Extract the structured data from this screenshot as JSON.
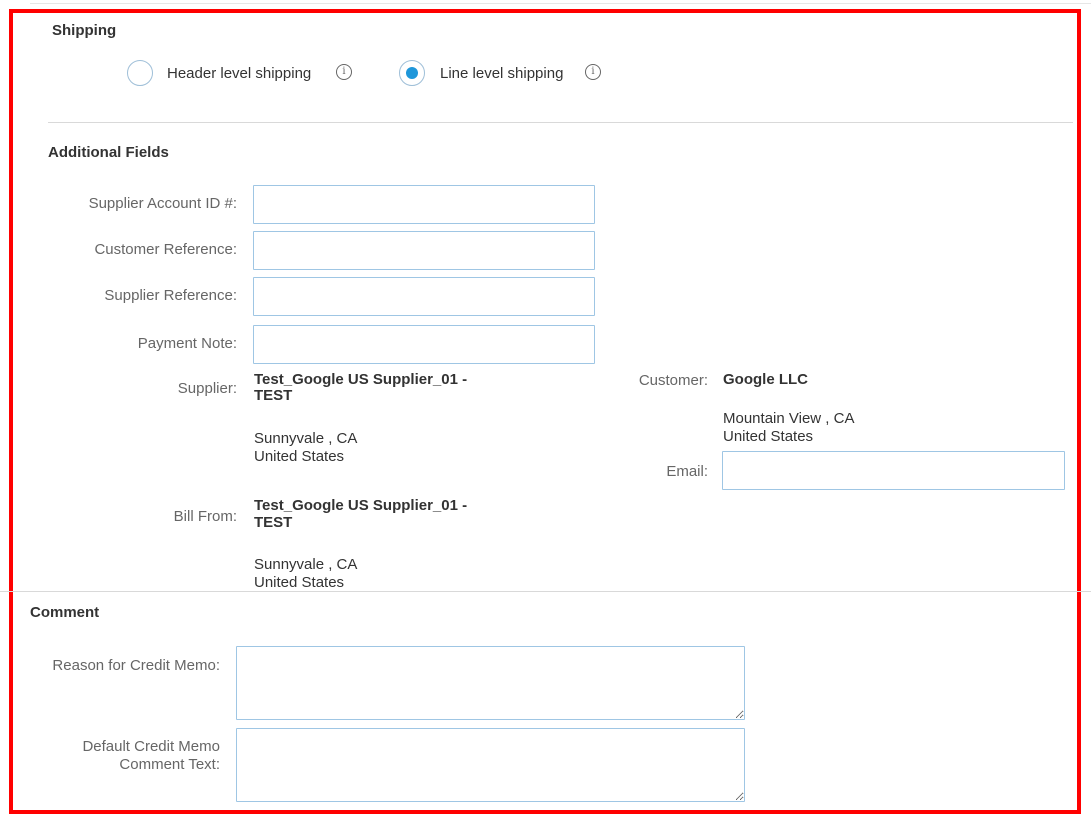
{
  "shipping": {
    "heading": "Shipping",
    "options": [
      {
        "label": "Header level shipping",
        "selected": false
      },
      {
        "label": "Line level shipping",
        "selected": true
      }
    ]
  },
  "additional_fields": {
    "heading": "Additional Fields",
    "supplier_account_id": {
      "label": "Supplier Account ID #:",
      "value": ""
    },
    "customer_reference": {
      "label": "Customer Reference:",
      "value": ""
    },
    "supplier_reference": {
      "label": "Supplier Reference:",
      "value": ""
    },
    "payment_note": {
      "label": "Payment Note:",
      "value": ""
    },
    "supplier": {
      "label": "Supplier:",
      "name_line1": "Test_Google US Supplier_01 -",
      "name_line2": "TEST",
      "city_state": "Sunnyvale , CA",
      "country": "United States"
    },
    "bill_from": {
      "label": "Bill From:",
      "name_line1": "Test_Google US Supplier_01 -",
      "name_line2": "TEST",
      "city_state": "Sunnyvale , CA",
      "country": "United States"
    },
    "customer": {
      "label": "Customer:",
      "name": "Google LLC",
      "city_state": "Mountain View , CA",
      "country": "United States"
    },
    "email": {
      "label": "Email:",
      "value": ""
    }
  },
  "comment": {
    "heading": "Comment",
    "reason": {
      "label": "Reason for Credit Memo:",
      "value": ""
    },
    "default_text": {
      "label_line1": "Default Credit Memo",
      "label_line2": "Comment Text:",
      "value": ""
    }
  },
  "colors": {
    "highlight_border": "#ff0000",
    "input_border": "#9fc6e4",
    "radio_selected": "#1f97da"
  }
}
